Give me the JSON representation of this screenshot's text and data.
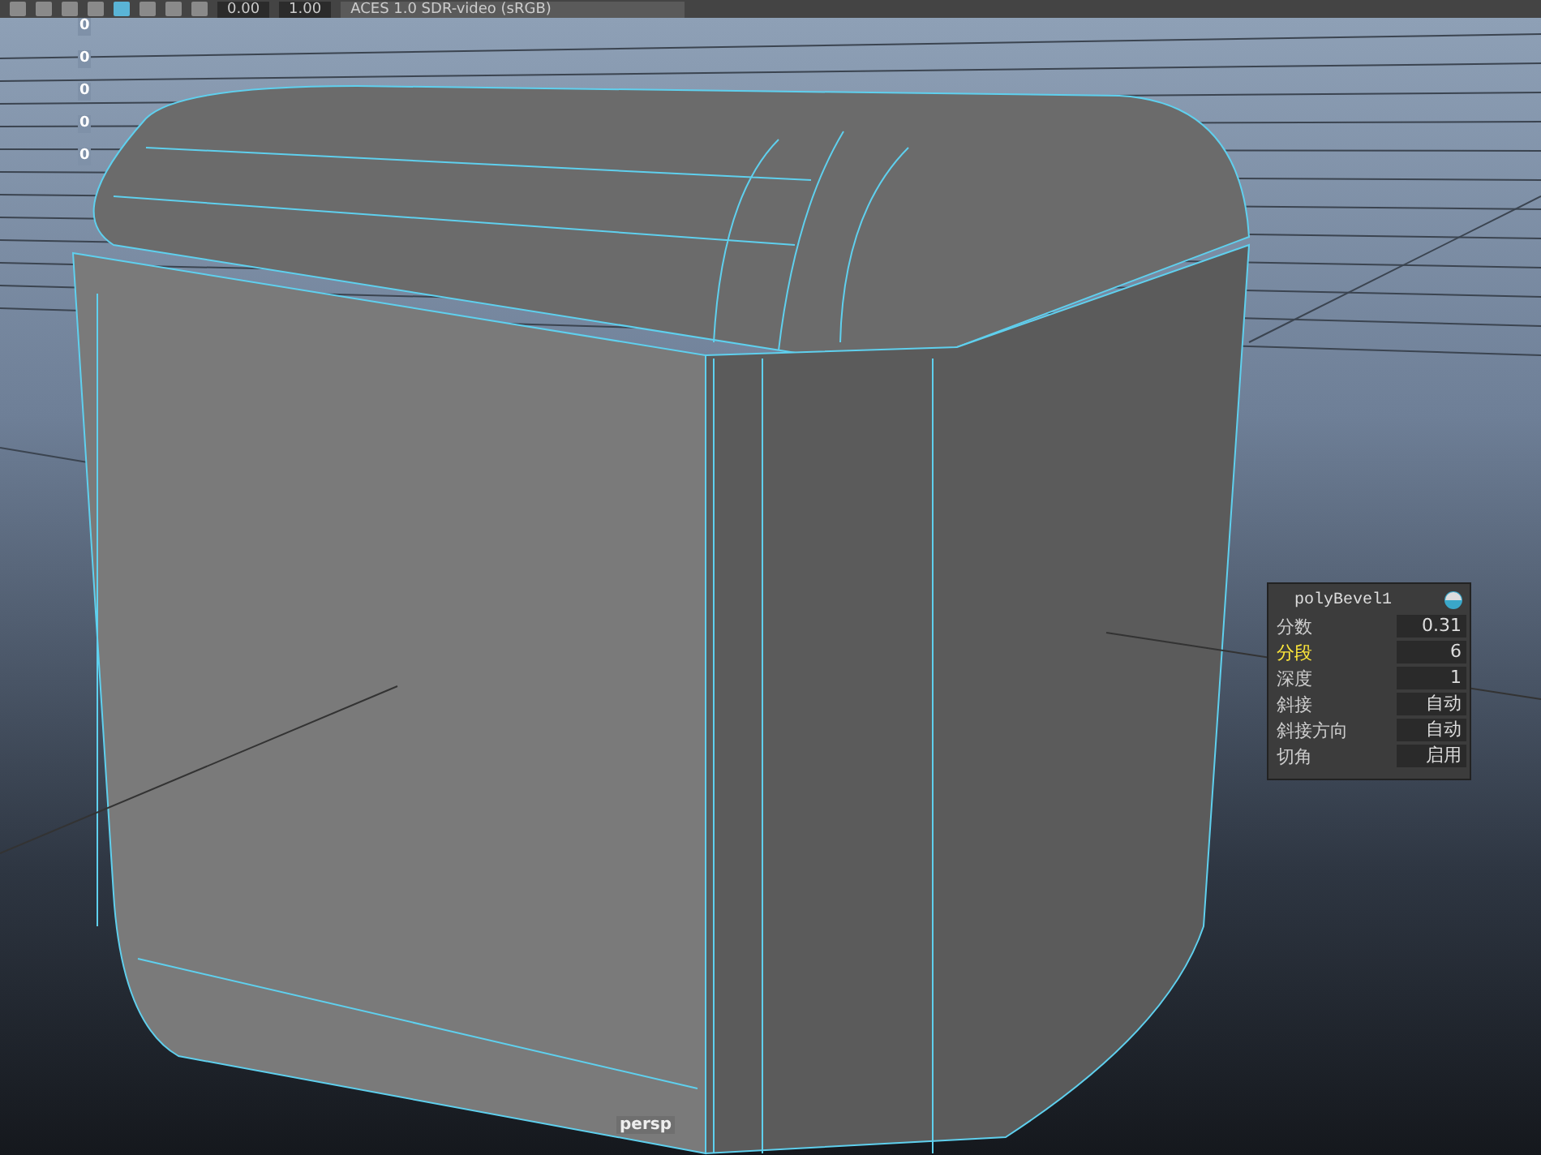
{
  "toolbar": {
    "exposure": "0.00",
    "gamma": "1.00",
    "color_space": "ACES 1.0 SDR-video (sRGB)"
  },
  "hud_values": [
    "0",
    "0",
    "0",
    "0",
    "0"
  ],
  "bevel_panel": {
    "title": "polyBevel1",
    "rows": [
      {
        "label": "分数",
        "value": "0.31",
        "selected": false
      },
      {
        "label": "分段",
        "value": "6",
        "selected": true
      },
      {
        "label": "深度",
        "value": "1",
        "selected": false
      },
      {
        "label": "斜接",
        "value": "自动",
        "selected": false
      },
      {
        "label": "斜接方向",
        "value": "自动",
        "selected": false
      },
      {
        "label": "切角",
        "value": "启用",
        "selected": false
      }
    ]
  },
  "camera_label": "persp"
}
